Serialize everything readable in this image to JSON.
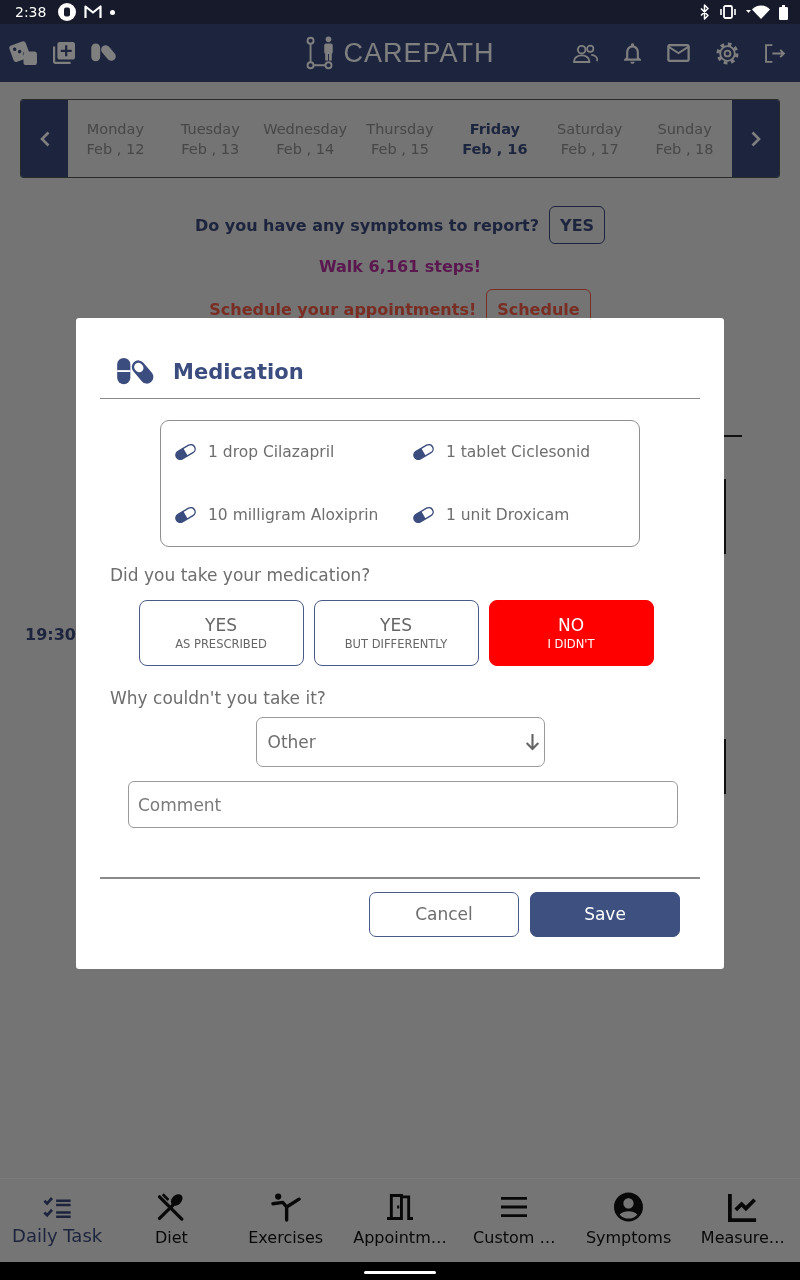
{
  "status_bar": {
    "time": "2:38"
  },
  "header": {
    "logo": "CAREPATH"
  },
  "week": {
    "days": [
      {
        "day": "Monday",
        "date": "Feb , 12",
        "selected": false
      },
      {
        "day": "Tuesday",
        "date": "Feb , 13",
        "selected": false
      },
      {
        "day": "Wednesday",
        "date": "Feb , 14",
        "selected": false
      },
      {
        "day": "Thursday",
        "date": "Feb , 15",
        "selected": false
      },
      {
        "day": "Friday",
        "date": "Feb , 16",
        "selected": true
      },
      {
        "day": "Saturday",
        "date": "Feb , 17",
        "selected": false
      },
      {
        "day": "Sunday",
        "date": "Feb , 18",
        "selected": false
      }
    ]
  },
  "reminders": [
    {
      "kind": "symptoms",
      "text": "Do you have any symptoms to report?",
      "button": "YES"
    },
    {
      "kind": "steps",
      "text": "Walk 6,161 steps!"
    },
    {
      "kind": "appointments",
      "text": "Schedule your appointments!",
      "button": "Schedule"
    }
  ],
  "timeline": {
    "time": "19:30"
  },
  "dialog": {
    "title": "Medication",
    "medications": [
      "1 drop Cilazapril",
      "1 tablet Ciclesonid",
      "10 milligram Aloxiprin",
      "1 unit Droxicam"
    ],
    "question": "Did you take your medication?",
    "options": [
      {
        "label": "YES",
        "sublabel": "AS PRESCRIBED",
        "selected": false
      },
      {
        "label": "YES",
        "sublabel": "BUT DIFFERENTLY",
        "selected": false
      },
      {
        "label": "NO",
        "sublabel": "I DIDN'T",
        "selected": true
      }
    ],
    "reason_question": "Why couldn't you take it?",
    "reason": {
      "value": "Other"
    },
    "comment": {
      "placeholder": "Comment"
    },
    "buttons": [
      {
        "label": "Cancel",
        "kind": "secondary"
      },
      {
        "label": "Save",
        "kind": "primary"
      }
    ]
  },
  "bottom_nav": [
    {
      "label": "Daily Task",
      "selected": true
    },
    {
      "label": "Diet",
      "selected": false
    },
    {
      "label": "Exercises",
      "selected": false
    },
    {
      "label": "Appointm…",
      "selected": false
    },
    {
      "label": "Custom …",
      "selected": false
    },
    {
      "label": "Symptoms",
      "selected": false
    },
    {
      "label": "Measure…",
      "selected": false
    }
  ]
}
